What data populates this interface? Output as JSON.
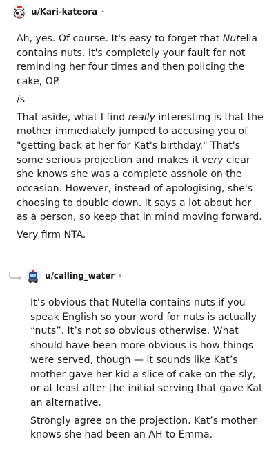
{
  "comment1": {
    "username": "u/Kari-kateora",
    "dot": "•",
    "avatar_icon": "cow-snoo-avatar-icon",
    "p1": [
      {
        "t": "Ah, yes. Of course. It's easy to forget that "
      },
      {
        "t": "Nut",
        "i": true
      },
      {
        "t": "ella contains nuts. It's completely your fault for not reminding her four times and then policing the cake, OP."
      }
    ],
    "p2": [
      {
        "t": "/s"
      }
    ],
    "p3": [
      {
        "t": "That aside, what I find "
      },
      {
        "t": "really",
        "i": true
      },
      {
        "t": " interesting is that the mother immediately jumped to accusing you of \"getting back at her for Kat's birthday.\" That's some serious projection and makes it "
      },
      {
        "t": "very",
        "i": true
      },
      {
        "t": " clear she knows she was a complete asshole on the occasion. However, instead of apologising, she's choosing to double down. It says a lot about her as a person, so keep that in mind moving forward."
      }
    ],
    "p4": [
      {
        "t": "Very firm NTA."
      }
    ]
  },
  "comment2": {
    "username": "u/calling_water",
    "dot": "•",
    "avatar_icon": "robot-snoo-avatar-icon",
    "reply_icon": "reply-arrow-icon",
    "p1": [
      {
        "t": "It’s obvious that Nutella contains nuts if you speak English so your word for nuts is actually “nuts”. It’s not so obvious otherwise. What should have been more obvious is how things were served, though — it sounds like Kat’s mother gave her kid a slice of cake on the sly, or at least after the initial serving that gave Kat an alternative."
      }
    ],
    "p2": [
      {
        "t": "Strongly agree on the projection. Kat’s mother knows she had been an AH to Emma."
      }
    ]
  }
}
